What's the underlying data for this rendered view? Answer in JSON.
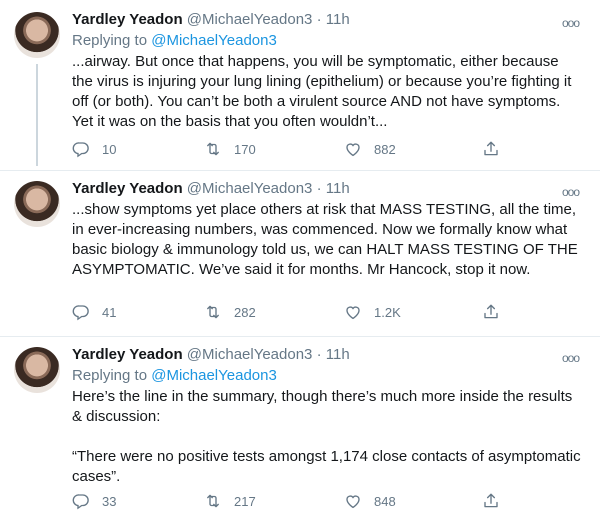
{
  "tweets": [
    {
      "name": "Yardley Yeadon",
      "handle": "@MichaelYeadon3",
      "separator": "·",
      "time": "11h",
      "more": "ooo",
      "replying_prefix": "Replying to",
      "replying_to": "@MichaelYeadon3",
      "text": "...airway. But once that happens, you will be symptomatic, either because the virus is injuring your lung lining (epithelium) or because you’re fighting it off (or both). You can’t be both a virulent source AND not have symptoms. Yet it was on the basis that you often wouldn’t...",
      "replies": "10",
      "retweets": "170",
      "likes": "882"
    },
    {
      "name": "Yardley Yeadon",
      "handle": "@MichaelYeadon3",
      "separator": "·",
      "time": "11h",
      "more": "ooo",
      "text": "...show symptoms yet place others at risk that MASS TESTING, all the time, in ever-increasing numbers, was commenced. Now we formally know what basic biology & immunology told us, we can HALT MASS TESTING OF THE ASYMPTOMATIC. We’ve said it for months. Mr Hancock, stop it now.",
      "replies": "41",
      "retweets": "282",
      "likes": "1.2K"
    },
    {
      "name": "Yardley Yeadon",
      "handle": "@MichaelYeadon3",
      "separator": "·",
      "time": "11h",
      "more": "ooo",
      "replying_prefix": "Replying to",
      "replying_to": "@MichaelYeadon3",
      "text_p1": "Here’s the line in the summary, though there’s much more inside the results & discussion:",
      "text_p2": "“There were no positive tests amongst 1,174 close contacts of asymptomatic cases”.",
      "replies": "33",
      "retweets": "217",
      "likes": "848"
    }
  ],
  "icons": {
    "reply": "reply-icon",
    "retweet": "retweet-icon",
    "like": "heart-icon",
    "share": "share-icon",
    "more": "more-options-icon"
  },
  "colors": {
    "link": "#1b95e0",
    "secondary": "#657786",
    "text": "#14171a",
    "divider": "#e6ecf0"
  }
}
